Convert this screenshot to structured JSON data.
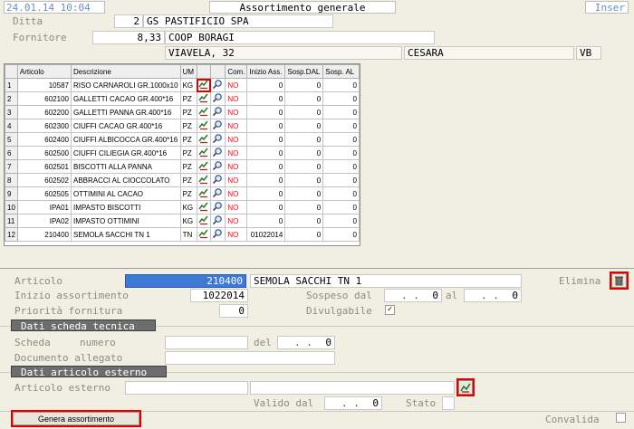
{
  "header": {
    "datetime": "24.01.14 10:04",
    "title": "Assortimento generale",
    "mode": "Inser"
  },
  "ditta": {
    "label": "Ditta",
    "code": "2",
    "name": "GS PASTIFICIO SPA"
  },
  "fornitore": {
    "label": "Fornitore",
    "code": "8,33",
    "name": "COOP BORAGI",
    "address": "VIAVELA, 32",
    "city": "CESARA",
    "province": "VB"
  },
  "grid": {
    "columns": [
      "Articolo",
      "Descrizione",
      "UM",
      "",
      "",
      "Com.",
      "Inizio Ass.",
      "Sosp.DAL",
      "Sosp. AL"
    ],
    "rows": [
      {
        "n": "1",
        "articolo": "10587",
        "descrizione": "RISO CARNAROLI GR.1000x10",
        "um": "KG",
        "com": "NO",
        "inizio": "0",
        "dal": "0",
        "al": "0"
      },
      {
        "n": "2",
        "articolo": "602100",
        "descrizione": "GALLETTI CACAO    GR.400*16",
        "um": "PZ",
        "com": "NO",
        "inizio": "0",
        "dal": "0",
        "al": "0"
      },
      {
        "n": "3",
        "articolo": "602200",
        "descrizione": "GALLETTI PANNA    GR.400*16",
        "um": "PZ",
        "com": "NO",
        "inizio": "0",
        "dal": "0",
        "al": "0"
      },
      {
        "n": "4",
        "articolo": "602300",
        "descrizione": "CIUFFI CACAO       GR.400*16",
        "um": "PZ",
        "com": "NO",
        "inizio": "0",
        "dal": "0",
        "al": "0"
      },
      {
        "n": "5",
        "articolo": "602400",
        "descrizione": "CIUFFI ALBICOCCA  GR.400*16",
        "um": "PZ",
        "com": "NO",
        "inizio": "0",
        "dal": "0",
        "al": "0"
      },
      {
        "n": "6",
        "articolo": "602500",
        "descrizione": "CIUFFI CILIEGIA   GR.400*16",
        "um": "PZ",
        "com": "NO",
        "inizio": "0",
        "dal": "0",
        "al": "0"
      },
      {
        "n": "7",
        "articolo": "602501",
        "descrizione": "BISCOTTI ALLA PANNA",
        "um": "PZ",
        "com": "NO",
        "inizio": "0",
        "dal": "0",
        "al": "0"
      },
      {
        "n": "8",
        "articolo": "602502",
        "descrizione": "ABBRACCI AL CIOCCOLATO",
        "um": "PZ",
        "com": "NO",
        "inizio": "0",
        "dal": "0",
        "al": "0"
      },
      {
        "n": "9",
        "articolo": "602505",
        "descrizione": "OTTIMINI AL CACAO",
        "um": "PZ",
        "com": "NO",
        "inizio": "0",
        "dal": "0",
        "al": "0"
      },
      {
        "n": "10",
        "articolo": "IPA01",
        "descrizione": "IMPASTO BISCOTTI",
        "um": "KG",
        "com": "NO",
        "inizio": "0",
        "dal": "0",
        "al": "0"
      },
      {
        "n": "11",
        "articolo": "IPA02",
        "descrizione": "IMPASTO OTTIMINI",
        "um": "KG",
        "com": "NO",
        "inizio": "0",
        "dal": "0",
        "al": "0"
      },
      {
        "n": "12",
        "articolo": "210400",
        "descrizione": "SEMOLA SACCHI     TN 1",
        "um": "TN",
        "com": "NO",
        "inizio": "01022014",
        "dal": "0",
        "al": "0"
      }
    ]
  },
  "detail": {
    "articolo_label": "Articolo",
    "articolo_code": "210400",
    "articolo_desc": "SEMOLA SACCHI     TN 1",
    "elimina_label": "Elimina",
    "inizio_label": "Inizio assortimento",
    "inizio_value": "1022014",
    "sospeso_label": "Sospeso dal",
    "sospeso_dal_sep": ". .",
    "sospeso_dal_value": "0",
    "al_label": "al",
    "sospeso_al_sep": ". .",
    "sospeso_al_value": "0",
    "priorita_label": "Priorità fornitura",
    "priorita_value": "0",
    "divulgabile_label": "Divulgabile",
    "divulgabile_mark": "✓"
  },
  "scheda": {
    "section_title": "Dati scheda tecnica",
    "scheda_label": "Scheda",
    "numero_label": "numero",
    "del_label": "del",
    "del_sep": ". .",
    "del_value": "0",
    "documento_label": "Documento allegato"
  },
  "esterno": {
    "section_title": "Dati articolo esterno",
    "articolo_label": "Articolo esterno",
    "valido_label": "Valido dal",
    "valido_sep": ". .",
    "valido_value": "0",
    "stato_label": "Stato"
  },
  "footer": {
    "genera_button": "Genera assortimento",
    "convalida_label": "Convalida"
  },
  "colors": {
    "selection": "#3c7ad4",
    "highlight": "#e00000",
    "section": "#6d6d6d",
    "background": "#f1efe2"
  }
}
